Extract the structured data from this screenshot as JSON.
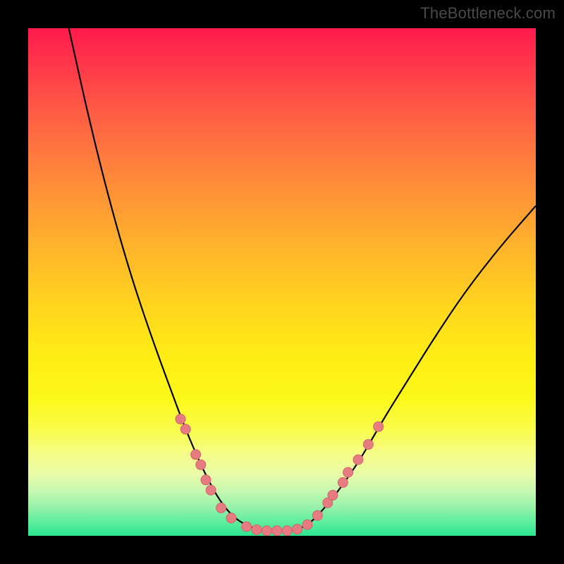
{
  "source_label": "TheBottleneck.com",
  "colors": {
    "curve": "#000000",
    "marker_fill": "#e77b82",
    "marker_stroke": "#d4646c"
  },
  "chart_data": {
    "type": "line",
    "title": "",
    "xlabel": "",
    "ylabel": "",
    "xlim": [
      0,
      100
    ],
    "ylim": [
      0,
      100
    ],
    "curve_notes": "y ≈ 100 is top (red/bad), y ≈ 0 is bottom (green/good). Curve is V-shaped with flat minimum.",
    "curve": [
      {
        "x": 8,
        "y": 100
      },
      {
        "x": 12,
        "y": 82
      },
      {
        "x": 16,
        "y": 66
      },
      {
        "x": 20,
        "y": 52
      },
      {
        "x": 24,
        "y": 40
      },
      {
        "x": 28,
        "y": 29
      },
      {
        "x": 31,
        "y": 21
      },
      {
        "x": 34,
        "y": 14
      },
      {
        "x": 37,
        "y": 8
      },
      {
        "x": 40,
        "y": 4
      },
      {
        "x": 43,
        "y": 2
      },
      {
        "x": 46,
        "y": 1
      },
      {
        "x": 49,
        "y": 1
      },
      {
        "x": 52,
        "y": 1
      },
      {
        "x": 55,
        "y": 2
      },
      {
        "x": 58,
        "y": 5
      },
      {
        "x": 62,
        "y": 10
      },
      {
        "x": 66,
        "y": 16
      },
      {
        "x": 70,
        "y": 23
      },
      {
        "x": 75,
        "y": 31
      },
      {
        "x": 80,
        "y": 39
      },
      {
        "x": 86,
        "y": 48
      },
      {
        "x": 93,
        "y": 57
      },
      {
        "x": 100,
        "y": 65
      }
    ],
    "markers": [
      {
        "x": 30,
        "y": 23
      },
      {
        "x": 31,
        "y": 21
      },
      {
        "x": 33,
        "y": 16
      },
      {
        "x": 34,
        "y": 14
      },
      {
        "x": 35,
        "y": 11
      },
      {
        "x": 36,
        "y": 9
      },
      {
        "x": 38,
        "y": 5.5
      },
      {
        "x": 40,
        "y": 3.5
      },
      {
        "x": 43,
        "y": 1.8
      },
      {
        "x": 45,
        "y": 1.2
      },
      {
        "x": 47,
        "y": 1.0
      },
      {
        "x": 49,
        "y": 1.0
      },
      {
        "x": 51,
        "y": 1.0
      },
      {
        "x": 53,
        "y": 1.3
      },
      {
        "x": 55,
        "y": 2.2
      },
      {
        "x": 57,
        "y": 4.0
      },
      {
        "x": 59,
        "y": 6.5
      },
      {
        "x": 60,
        "y": 8.0
      },
      {
        "x": 62,
        "y": 10.5
      },
      {
        "x": 63,
        "y": 12.5
      },
      {
        "x": 65,
        "y": 15.0
      },
      {
        "x": 67,
        "y": 18.0
      },
      {
        "x": 69,
        "y": 21.5
      }
    ]
  }
}
